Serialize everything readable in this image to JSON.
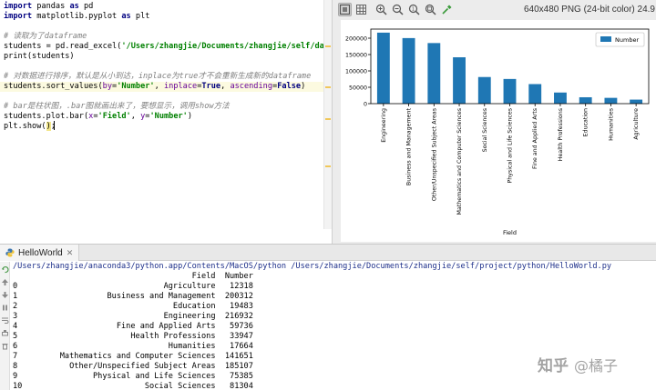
{
  "editor": {
    "code_lines": [
      [
        {
          "t": "import",
          "c": "kw"
        },
        {
          "t": " pandas "
        },
        {
          "t": "as",
          "c": "kw"
        },
        {
          "t": " pd"
        }
      ],
      [
        {
          "t": "import",
          "c": "kw"
        },
        {
          "t": " matplotlib.pyplot "
        },
        {
          "t": "as",
          "c": "kw"
        },
        {
          "t": " plt"
        }
      ],
      [],
      [
        {
          "t": "# 读取为了",
          "c": "cm"
        },
        {
          "t": "dataframe",
          "c": "cm"
        }
      ],
      [
        {
          "t": "students = pd.read_excel("
        },
        {
          "t": "'/Users/zhangjie/Documents/zhangjie/self/data/le",
          "c": "str"
        }
      ],
      [
        {
          "t": "print(students)"
        }
      ],
      [],
      [
        {
          "t": "# 对数据进行排序，默认是从小到达，inplace为true才不会重新生成新的dataframe",
          "c": "cm"
        }
      ],
      [
        {
          "t": "students.sort_values("
        },
        {
          "t": "by",
          "c": "arg"
        },
        {
          "t": "="
        },
        {
          "t": "'Number'",
          "c": "str"
        },
        {
          "t": ", "
        },
        {
          "t": "inplace",
          "c": "arg"
        },
        {
          "t": "="
        },
        {
          "t": "True",
          "c": "kwc"
        },
        {
          "t": ", "
        },
        {
          "t": "ascending",
          "c": "arg"
        },
        {
          "t": "="
        },
        {
          "t": "False",
          "c": "kwc"
        },
        {
          "t": ")"
        }
      ],
      [],
      [
        {
          "t": "# bar是柱状图，.bar图就画出来了，要想显示，调用show方法",
          "c": "cm"
        }
      ],
      [
        {
          "t": "students.plot.bar("
        },
        {
          "t": "x",
          "c": "arg"
        },
        {
          "t": "="
        },
        {
          "t": "'Field'",
          "c": "str"
        },
        {
          "t": ", "
        },
        {
          "t": "y",
          "c": "arg"
        },
        {
          "t": "="
        },
        {
          "t": "'Number'",
          "c": "str"
        },
        {
          "t": ")"
        }
      ],
      [
        {
          "t": "plt.show("
        },
        {
          "t": ")",
          "c": "paren-hl"
        },
        {
          "t": ";"
        }
      ]
    ],
    "highlighted_line": 8,
    "marker_colors": [
      "#f0c75a",
      "#f0c75a",
      "#f0c75a",
      "#f0c75a"
    ]
  },
  "plot_window": {
    "toolbar_icons": [
      "fit-icon",
      "grid-icon",
      "zoom-in-icon",
      "zoom-out-icon",
      "actual-size-icon",
      "zoom-fit-icon",
      "color-picker-icon"
    ],
    "image_info": "640x480 PNG (24-bit color) 24.9"
  },
  "chart_data": {
    "type": "bar",
    "categories": [
      "Engineering",
      "Business and Management",
      "Other/Unspecified Subject Areas",
      "Mathematics and Computer Sciences",
      "Social Sciences",
      "Physical and Life Sciences",
      "Fine and Applied Arts",
      "Health Professions",
      "Education",
      "Humanities",
      "Agriculture"
    ],
    "series": [
      {
        "name": "Number",
        "values": [
          216932,
          200312,
          185107,
          141651,
          81304,
          75385,
          59736,
          33947,
          19483,
          17664,
          12318
        ]
      }
    ],
    "xlabel": "Field",
    "ylabel": "",
    "ylim": [
      0,
      227779
    ],
    "yticks": [
      0,
      50000,
      100000,
      150000,
      200000
    ],
    "legend_position": "top-right",
    "bar_color": "#1f77b4"
  },
  "run": {
    "tab_label": "HelloWorld",
    "command": "/Users/zhangjie/anaconda3/python.app/Contents/MacOS/python /Users/zhangjie/Documents/zhangjie/self/project/python/HelloWorld.py",
    "table_header": [
      "Field",
      "Number"
    ],
    "table_rows": [
      [
        0,
        "Agriculture",
        12318
      ],
      [
        1,
        "Business and Management",
        200312
      ],
      [
        2,
        "Education",
        19483
      ],
      [
        3,
        "Engineering",
        216932
      ],
      [
        4,
        "Fine and Applied Arts",
        59736
      ],
      [
        5,
        "Health Professions",
        33947
      ],
      [
        6,
        "Humanities",
        17664
      ],
      [
        7,
        "Mathematics and Computer Sciences",
        141651
      ],
      [
        8,
        "Other/Unspecified Subject Areas",
        185107
      ],
      [
        9,
        "Physical and Life Sciences",
        75385
      ],
      [
        10,
        "Social Sciences",
        81304
      ]
    ],
    "gutter_icons": [
      "rerun-icon",
      "up-arrow-icon",
      "down-arrow-icon",
      "pause-icon",
      "wrap-icon",
      "print-icon",
      "trash-icon"
    ]
  },
  "watermark": {
    "brand": "知乎",
    "author": "@橘子"
  }
}
